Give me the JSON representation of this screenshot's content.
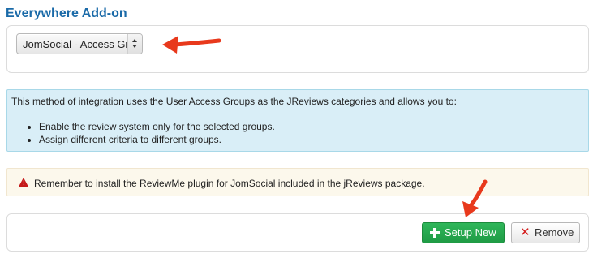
{
  "header": {
    "title": "Everywhere Add-on"
  },
  "addon_select": {
    "selected_value": "JomSocial - Access Groups"
  },
  "info": {
    "intro": "This method of integration uses the User Access Groups as the JReviews categories and allows you to:",
    "items": [
      "Enable the review system only for the selected groups.",
      "Assign different criteria to different groups."
    ]
  },
  "warning": {
    "icon": "warning-triangle-icon",
    "text": "Remember to install the ReviewMe plugin for JomSocial included in the jReviews package."
  },
  "actions": {
    "setup_new_label": "Setup New",
    "setup_new_icon": "plus-icon",
    "remove_label": "Remove",
    "remove_icon": "x-icon"
  },
  "colors": {
    "title": "#1a6aa8",
    "info_bg": "#d9eef7",
    "warning_bg": "#fcf8ec",
    "setup_button": "#1f9b45",
    "remove_icon": "#d41c1c",
    "annotation_arrow": "#e8391c"
  }
}
